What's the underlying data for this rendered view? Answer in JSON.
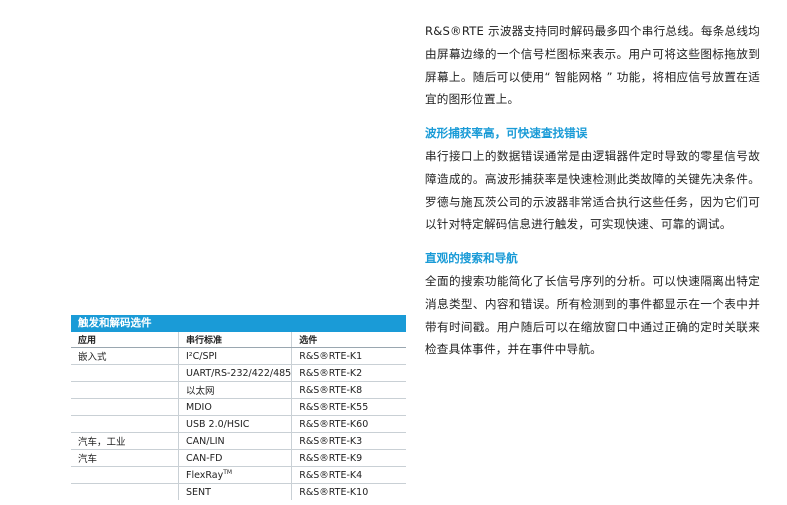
{
  "right_column": {
    "intro_paragraph": "R&S®RTE 示波器支持同时解码最多四个串行总线。每条总线均由屏幕边缘的一个信号栏图标来表示。用户可将这些图标拖放到屏幕上。随后可以使用“ 智能网格 ” 功能，将相应信号放置在适宜的图形位置上。",
    "section1_heading": "波形捕获率高，可快速查找错误",
    "section1_paragraph": "串行接口上的数据错误通常是由逻辑器件定时导致的零星信号故障造成的。高波形捕获率是快速检测此类故障的关键先决条件。罗德与施瓦茨公司的示波器非常适合执行这些任务，因为它们可以针对特定解码信息进行触发，可实现快速、可靠的调试。",
    "section2_heading": "直观的搜索和导航",
    "section2_paragraph": "全面的搜索功能简化了长信号序列的分析。可以快速隔离出特定消息类型、内容和错误。所有检测到的事件都显示在一个表中并带有时间戳。用户随后可以在缩放窗口中通过正确的定时关联来检查具体事件，并在事件中导航。"
  },
  "table": {
    "title": "触发和解码选件",
    "headers": [
      "应用",
      "串行标准",
      "选件"
    ],
    "rows": [
      {
        "app": "嵌入式",
        "standard": "I²C/SPI",
        "sup": "",
        "option": "R&S®RTE-K1"
      },
      {
        "app": "",
        "standard": "UART/RS-232/422/485",
        "sup": "",
        "option": "R&S®RTE-K2"
      },
      {
        "app": "",
        "standard": "以太网",
        "sup": "",
        "option": "R&S®RTE-K8"
      },
      {
        "app": "",
        "standard": "MDIO",
        "sup": "",
        "option": "R&S®RTE-K55"
      },
      {
        "app": "",
        "standard": "USB 2.0/HSIC",
        "sup": "",
        "option": "R&S®RTE-K60"
      },
      {
        "app": "汽车，工业",
        "standard": "CAN/LIN",
        "sup": "",
        "option": "R&S®RTE-K3"
      },
      {
        "app": "汽车",
        "standard": "CAN-FD",
        "sup": "",
        "option": "R&S®RTE-K9"
      },
      {
        "app": "",
        "standard": "FlexRay",
        "sup": "TM",
        "option": "R&S®RTE-K4"
      },
      {
        "app": "",
        "standard": "SENT",
        "sup": "",
        "option": "R&S®RTE-K10"
      }
    ]
  }
}
